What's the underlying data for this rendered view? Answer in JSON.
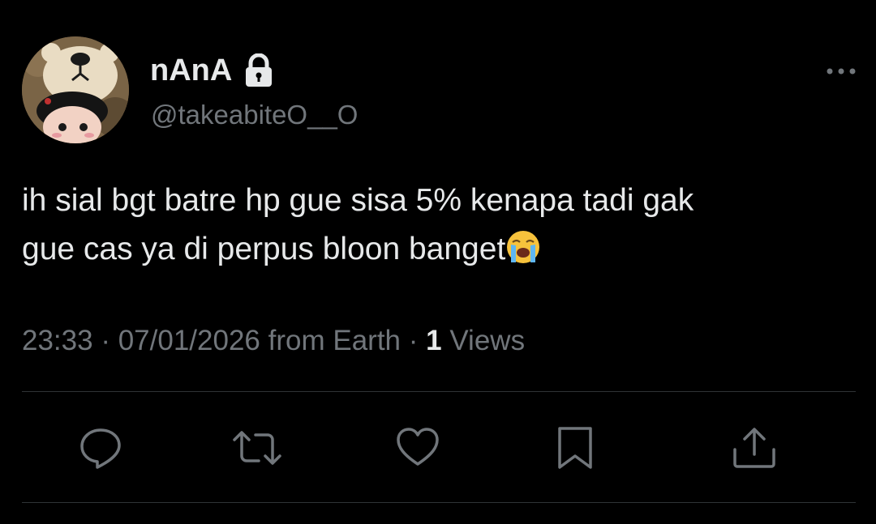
{
  "tweet": {
    "author": {
      "display_name": "nAnA",
      "handle": "@takeabiteO__O",
      "protected": true
    },
    "text_line_1": "ih sial bgt batre hp gue sisa 5% kenapa tadi gak",
    "text_line_2": "gue cas ya di perpus bloon banget",
    "emoji": "loudly-crying-face",
    "time": "23:33",
    "date": "07/01/2026",
    "source": "from Earth",
    "separator": "·",
    "views_count": "1",
    "views_label": "Views"
  },
  "icons": {
    "lock": "lock-icon",
    "more": "more-icon",
    "reply": "reply-icon",
    "retweet": "retweet-icon",
    "like": "heart-icon",
    "bookmark": "bookmark-icon",
    "share": "share-icon"
  },
  "colors": {
    "background": "#000000",
    "primary_text": "#e7e9ea",
    "secondary_text": "#71767b",
    "divider": "#2f3336"
  }
}
